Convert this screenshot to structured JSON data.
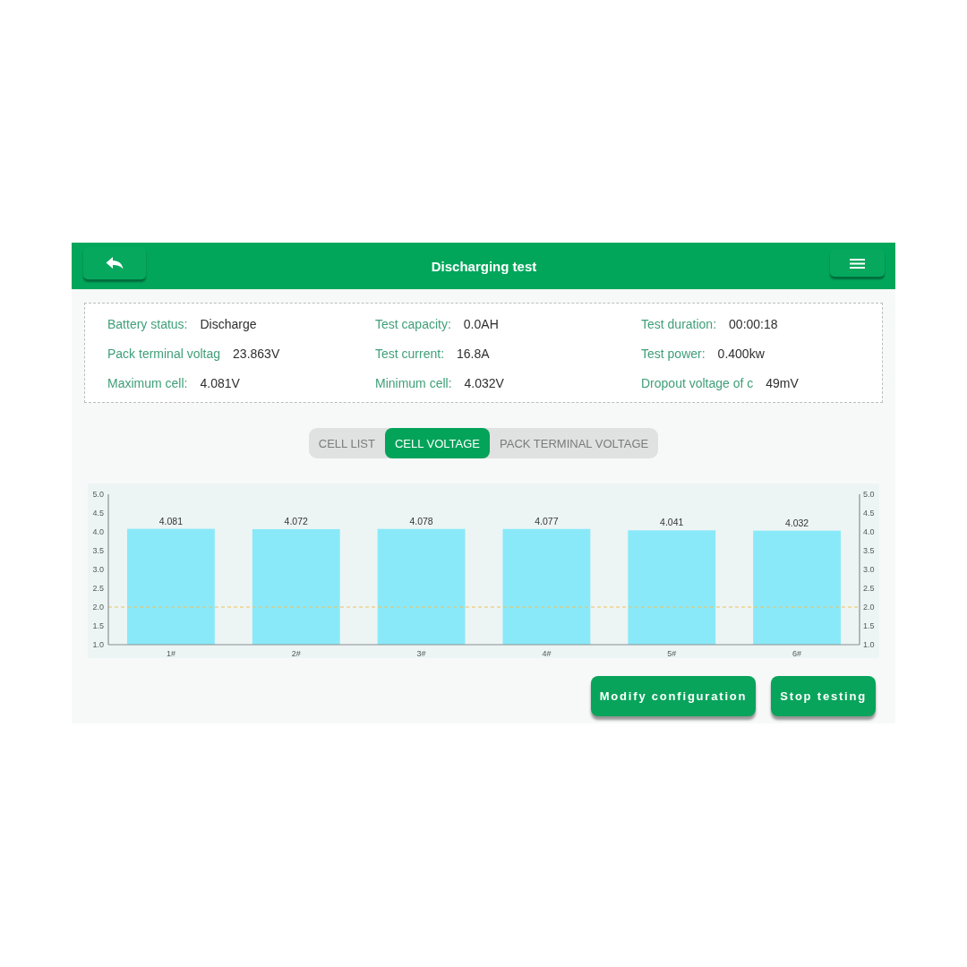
{
  "header": {
    "title": "Discharging test"
  },
  "info": [
    {
      "label": "Battery status:",
      "value": "Discharge"
    },
    {
      "label": "Test capacity:",
      "value": "0.0AH"
    },
    {
      "label": "Test duration:",
      "value": "00:00:18"
    },
    {
      "label": "Pack terminal voltag",
      "value": "23.863V"
    },
    {
      "label": "Test current:",
      "value": "16.8A"
    },
    {
      "label": "Test power:",
      "value": "0.400kw"
    },
    {
      "label": "Maximum cell:",
      "value": "4.081V"
    },
    {
      "label": "Minimum cell:",
      "value": "4.032V"
    },
    {
      "label": "Dropout voltage of c",
      "value": "49mV"
    }
  ],
  "tabs": [
    {
      "label": "CELL LIST",
      "selected": false
    },
    {
      "label": "CELL VOLTAGE",
      "selected": true
    },
    {
      "label": "PACK TERMINAL VOLTAGE",
      "selected": false
    }
  ],
  "chart": {
    "chart_data": {
      "type": "bar",
      "categories": [
        "1#",
        "2#",
        "3#",
        "4#",
        "5#",
        "6#"
      ],
      "series": [
        {
          "color": "#8ae9f9",
          "values": [
            4.081,
            4.072,
            4.078,
            4.077,
            4.041,
            4.032
          ]
        }
      ],
      "ylim": [
        1.0,
        5.0
      ],
      "yticks": [
        {
          "value": 1.0,
          "label": "1.0"
        },
        {
          "value": 1.5,
          "label": "1.5"
        },
        {
          "value": 2.0,
          "label": "2.0"
        },
        {
          "value": 2.5,
          "label": "2.5"
        },
        {
          "value": 3.0,
          "label": "3.0"
        },
        {
          "value": 3.5,
          "label": "3.5"
        },
        {
          "value": 4.0,
          "label": "4.0"
        },
        {
          "value": 4.5,
          "label": "4.5"
        },
        {
          "value": 5.0,
          "label": "5.0"
        }
      ],
      "value_labels": [
        "4.081",
        "4.072",
        "4.078",
        "4.077",
        "4.041",
        "4.032"
      ],
      "ref_lines": [
        {
          "axis": "y",
          "value": 2.0
        }
      ]
    }
  },
  "buttons": [
    "Modify configuration",
    "Stop testing"
  ]
}
